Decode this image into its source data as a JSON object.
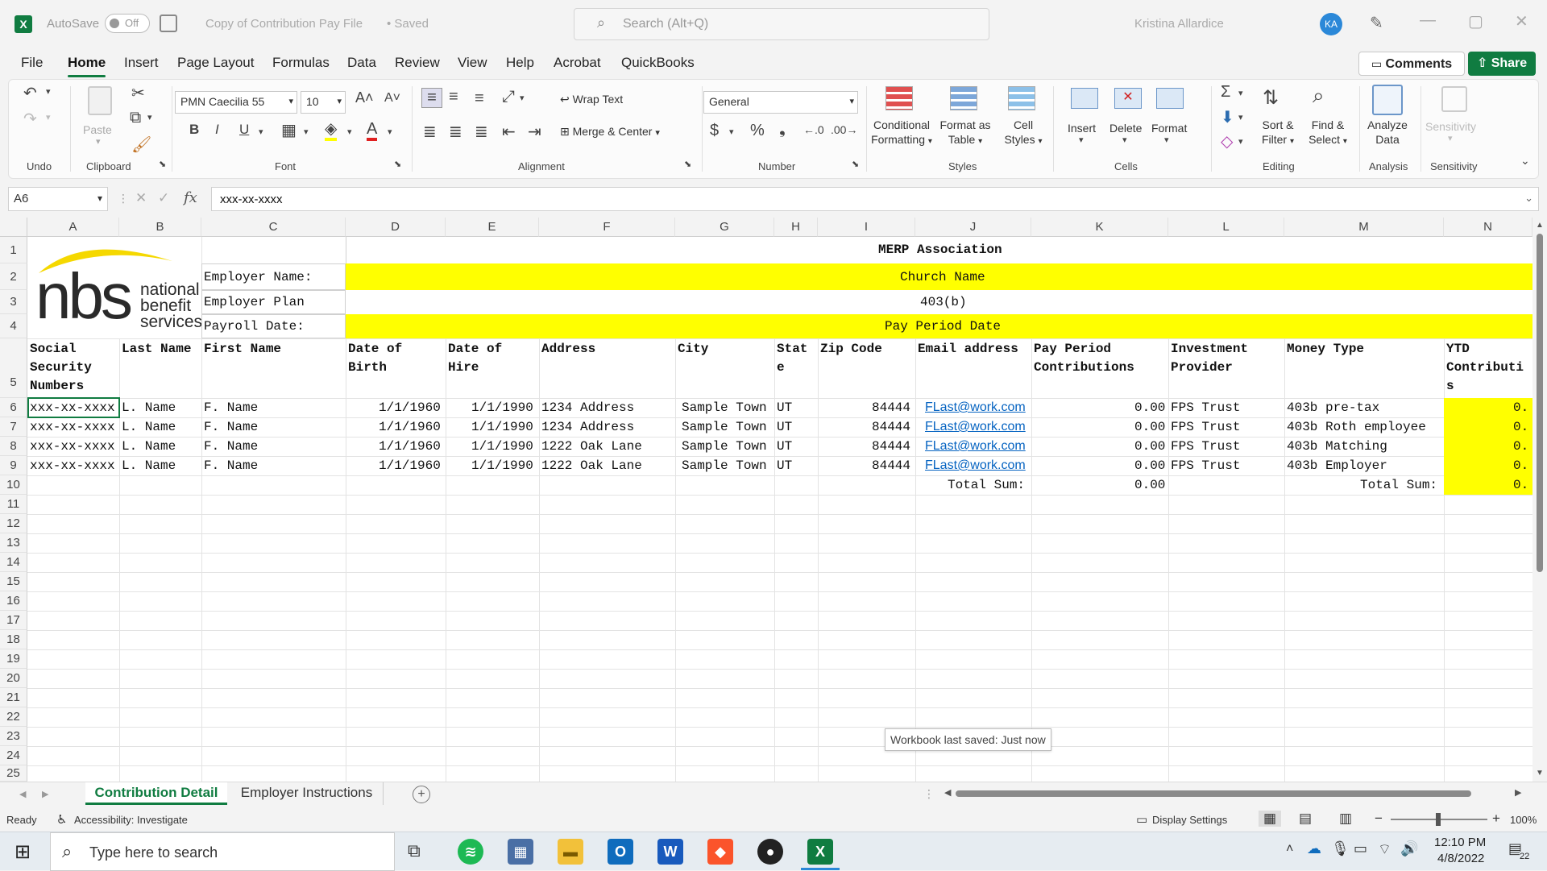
{
  "titlebar": {
    "autosave_label": "AutoSave",
    "autosave_state": "Off",
    "doc_title": "Copy of Contribution Pay File",
    "saved_status": "• Saved",
    "search_placeholder": "Search (Alt+Q)",
    "user_name": "Kristina Allardice",
    "user_initials": "KA"
  },
  "menu_tabs": [
    "File",
    "Home",
    "Insert",
    "Page Layout",
    "Formulas",
    "Data",
    "Review",
    "View",
    "Help",
    "Acrobat",
    "QuickBooks"
  ],
  "active_tab": "Home",
  "comments_label": "Comments",
  "share_label": "Share",
  "ribbon": {
    "undo_label": "Undo",
    "clipboard": {
      "paste": "Paste",
      "label": "Clipboard"
    },
    "font": {
      "name": "PMN Caecilia 55",
      "size": "10",
      "label": "Font"
    },
    "alignment": {
      "wrap": "Wrap Text",
      "merge": "Merge & Center",
      "label": "Alignment"
    },
    "number": {
      "format": "General",
      "label": "Number"
    },
    "styles": {
      "cond_line1": "Conditional",
      "cond_line2": "Formatting",
      "fmt_line1": "Format as",
      "fmt_line2": "Table",
      "cell_line1": "Cell",
      "cell_line2": "Styles",
      "label": "Styles"
    },
    "cells": {
      "insert": "Insert",
      "delete": "Delete",
      "format": "Format",
      "label": "Cells"
    },
    "editing": {
      "sort_line1": "Sort &",
      "sort_line2": "Filter",
      "find_line1": "Find &",
      "find_line2": "Select",
      "label": "Editing"
    },
    "analysis": {
      "analyze_line1": "Analyze",
      "analyze_line2": "Data",
      "label": "Analysis"
    },
    "sensitivity": {
      "btn": "Sensitivity",
      "label": "Sensitivity"
    }
  },
  "formula": {
    "namebox": "A6",
    "fx": "fx",
    "content": "xxx-xx-xxxx"
  },
  "columns": [
    "A",
    "B",
    "C",
    "D",
    "E",
    "F",
    "G",
    "H",
    "I",
    "J",
    "K",
    "L",
    "M",
    "N"
  ],
  "rows": [
    "1",
    "2",
    "3",
    "4",
    "5",
    "6",
    "7",
    "8",
    "9",
    "10",
    "11",
    "12",
    "13",
    "14",
    "15",
    "16",
    "17",
    "18",
    "19",
    "20",
    "21",
    "22",
    "23",
    "24",
    "25"
  ],
  "logo": {
    "letters": "nbs",
    "line1": "national",
    "line2": "benefit",
    "line3": "services"
  },
  "sheet": {
    "association": "MERP Association",
    "employer_name_label": "Employer Name:",
    "employer_name": "Church Name",
    "employer_plan_label": "Employer Plan",
    "employer_plan": "403(b)",
    "payroll_date_label": "Payroll Date:",
    "payroll_date": "Pay Period Date",
    "headers": {
      "ssn": "Social\nSecurity\nNumbers",
      "last": "Last Name",
      "first": "First Name",
      "dob": "Date of\nBirth",
      "doh": "Date of\nHire",
      "address": "Address",
      "city": "City",
      "state": "Stat\ne",
      "zip": "Zip Code",
      "email": "Email address",
      "contrib": "Pay Period\nContributions",
      "provider": "Investment\nProvider",
      "money": "Money Type",
      "ytd": "YTD\nContributi\ns"
    },
    "data_rows": [
      {
        "ssn": "xxx-xx-xxxx",
        "last": "L. Name",
        "first": "F. Name",
        "dob": "1/1/1960",
        "doh": "1/1/1990",
        "address": "1234 Address",
        "city": "Sample Town",
        "state": "UT",
        "zip": "84444",
        "email": "FLast@work.com",
        "contrib": "0.00",
        "provider": "FPS Trust",
        "money": "403b pre-tax",
        "ytd": "0."
      },
      {
        "ssn": "xxx-xx-xxxx",
        "last": "L. Name",
        "first": "F. Name",
        "dob": "1/1/1960",
        "doh": "1/1/1990",
        "address": "1234 Address",
        "city": "Sample Town",
        "state": "UT",
        "zip": "84444",
        "email": "FLast@work.com",
        "contrib": "0.00",
        "provider": "FPS Trust",
        "money": "403b Roth employee",
        "ytd": "0."
      },
      {
        "ssn": "xxx-xx-xxxx",
        "last": "L. Name",
        "first": "F. Name",
        "dob": "1/1/1960",
        "doh": "1/1/1990",
        "address": "1222 Oak Lane",
        "city": "Sample Town",
        "state": "UT",
        "zip": "84444",
        "email": "FLast@work.com",
        "contrib": "0.00",
        "provider": "FPS Trust",
        "money": "403b Matching",
        "ytd": "0."
      },
      {
        "ssn": "xxx-xx-xxxx",
        "last": "L. Name",
        "first": "F. Name",
        "dob": "1/1/1960",
        "doh": "1/1/1990",
        "address": "1222 Oak Lane",
        "city": "Sample Town",
        "state": "UT",
        "zip": "84444",
        "email": "FLast@work.com",
        "contrib": "0.00",
        "provider": "FPS Trust",
        "money": "403b Employer",
        "ytd": "0."
      }
    ],
    "total_label_1": "Total Sum:",
    "total_value_1": "0.00",
    "total_label_2": "Total Sum:",
    "total_value_2": "0."
  },
  "tooltip": "Workbook last saved: Just now",
  "sheet_tabs": [
    "Contribution Detail",
    "Employer Instructions"
  ],
  "status": {
    "ready": "Ready",
    "accessibility": "Accessibility: Investigate",
    "display": "Display Settings",
    "zoom": "100%"
  },
  "taskbar": {
    "search_placeholder": "Type here to search",
    "time": "12:10 PM",
    "date": "4/8/2022",
    "notif_count": "22"
  },
  "colors": {
    "accent": "#107c41",
    "yellow": "#ffff00",
    "link": "#0563c1"
  }
}
